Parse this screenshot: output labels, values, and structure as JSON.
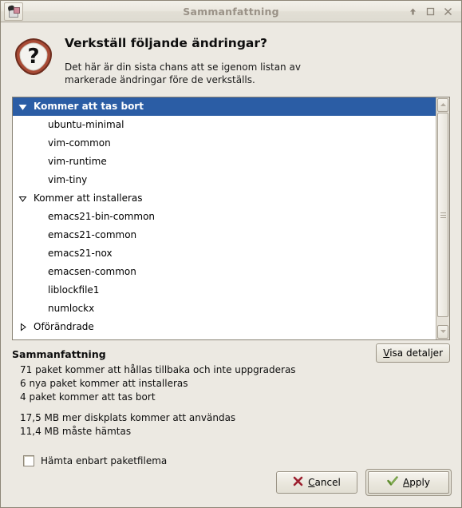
{
  "window": {
    "title": "Sammanfattning",
    "icon": "synaptic-package-icon",
    "buttons": {
      "shade": "shade-window",
      "maximize": "maximize-window",
      "close": "close-window"
    }
  },
  "header": {
    "icon": "question-shield-icon",
    "title": "Verkställ följande ändringar?",
    "description": "Det här är din sista chans att se igenom listan av markerade ändringar före de verkställs."
  },
  "tree": {
    "groups": [
      {
        "label": "Kommer att tas bort",
        "expanded": true,
        "selected": true,
        "items": [
          "ubuntu-minimal",
          "vim-common",
          "vim-runtime",
          "vim-tiny"
        ]
      },
      {
        "label": "Kommer att installeras",
        "expanded": true,
        "selected": false,
        "items": [
          "emacs21-bin-common",
          "emacs21-common",
          "emacs21-nox",
          "emacsen-common",
          "liblockfile1",
          "numlockx"
        ]
      },
      {
        "label": "Oförändrade",
        "expanded": false,
        "selected": false,
        "items": []
      }
    ]
  },
  "summary": {
    "heading": "Sammanfattning",
    "lines_group_1": [
      "71 paket kommer att hållas tillbaka och inte uppgraderas",
      "6 nya paket kommer att installeras",
      "4 paket kommer att tas bort"
    ],
    "lines_group_2": [
      "17,5 MB mer diskplats kommer att användas",
      "11,4 MB måste hämtas"
    ],
    "details_button": "Visa detaljer",
    "details_mnemonic": "V",
    "details_rest": "isa detaljer"
  },
  "options": {
    "download_only_label": "Hämta enbart paketfilema",
    "download_only_checked": false
  },
  "actions": {
    "cancel": {
      "mnemonic": "C",
      "rest": "ancel",
      "icon": "cancel-x-icon",
      "color": "#9c1f2e"
    },
    "apply": {
      "mnemonic": "A",
      "rest": "pply",
      "icon": "apply-check-icon",
      "color": "#4f7a23",
      "default": true
    }
  },
  "colors": {
    "selection": "#2b5da5",
    "window_bg": "#ece9e2",
    "list_bg": "#ffffff",
    "title_text": "#9a9287"
  }
}
